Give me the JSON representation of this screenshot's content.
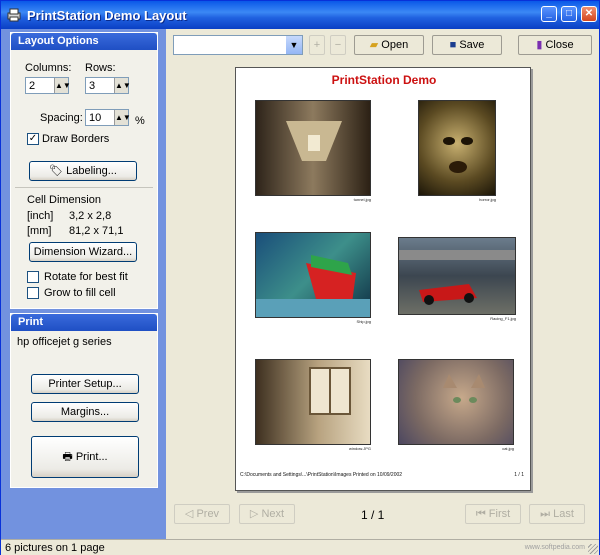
{
  "window": {
    "title": "PrintStation Demo Layout",
    "controls": {
      "minimize": "_",
      "maximize": "□",
      "close": "✕"
    }
  },
  "layout_options": {
    "header": "Layout Options",
    "columns_label": "Columns:",
    "columns_value": "2",
    "rows_label": "Rows:",
    "rows_value": "3",
    "spacing_label": "Spacing:",
    "spacing_value": "10",
    "spacing_unit": "%",
    "draw_borders_label": "Draw Borders",
    "draw_borders_checked": true,
    "labeling_button": "Labeling...",
    "cell_dimension_label": "Cell Dimension",
    "inch_unit": "[inch]",
    "inch_value": "3,2 x 2,8",
    "mm_unit": "[mm]",
    "mm_value": "81,2 x 71,1",
    "dimension_wizard_button": "Dimension Wizard...",
    "rotate_label": "Rotate for best fit",
    "grow_label": "Grow to fill cell"
  },
  "print_panel": {
    "header": "Print",
    "printer_name": "hp officejet g series",
    "printer_setup_button": "Printer Setup...",
    "margins_button": "Margins...",
    "print_button": "Print..."
  },
  "toolbar": {
    "combo_value": "",
    "open_label": "Open",
    "save_label": "Save",
    "close_label": "Close"
  },
  "preview": {
    "page_title": "PrintStation Demo",
    "captions": [
      "tunnel.jpg",
      "horror.jpg",
      "Ship.jpg",
      "Racing_F1.jpg",
      "window.JPG",
      "cat.jpg"
    ],
    "footer_left": "C:\\Documents and Settings\\...\\PrintStation\\Images  Printed on 10/09/2002",
    "footer_right": "1 / 1"
  },
  "navigation": {
    "prev_label": "Prev",
    "next_label": "Next",
    "page_indicator": "1 / 1",
    "first_label": "First",
    "last_label": "Last"
  },
  "status": {
    "text": "6 pictures on 1 page",
    "watermark": "www.softpedia.com"
  },
  "colors": {
    "title_bar": "#2061e0",
    "panel_bg": "#7292df",
    "page_title": "#cc1111"
  }
}
